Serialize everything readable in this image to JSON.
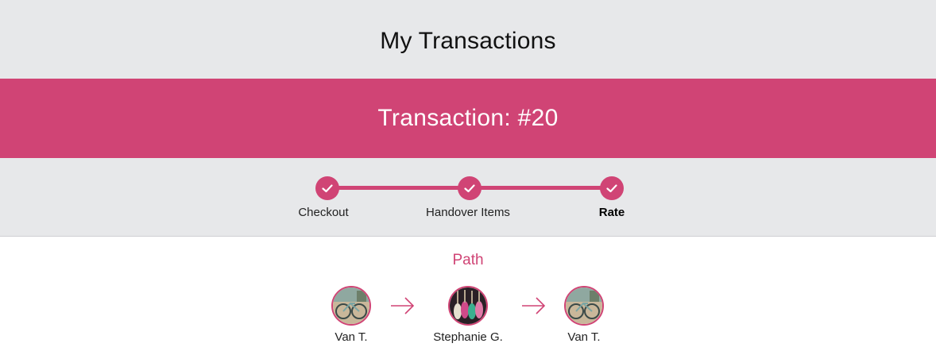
{
  "header": {
    "title": "My Transactions"
  },
  "transaction": {
    "title": "Transaction: #20"
  },
  "progress": {
    "steps": [
      {
        "label": "Checkout",
        "completed": true,
        "active": false
      },
      {
        "label": "Handover Items",
        "completed": true,
        "active": false
      },
      {
        "label": "Rate",
        "completed": true,
        "active": true
      }
    ]
  },
  "path": {
    "title": "Path",
    "nodes": [
      {
        "name": "Van T.",
        "avatar": "bicycle-photo"
      },
      {
        "name": "Stephanie G.",
        "avatar": "guitars-photo"
      },
      {
        "name": "Van T.",
        "avatar": "bicycle-photo"
      }
    ]
  },
  "colors": {
    "accent": "#d04475",
    "header_bg": "#e7e8ea",
    "page_bg": "#ffffff"
  }
}
